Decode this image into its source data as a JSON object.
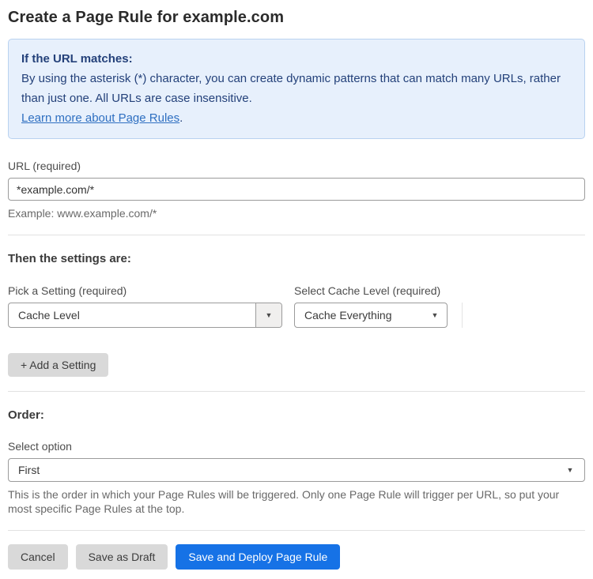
{
  "page": {
    "title": "Create a Page Rule for example.com"
  },
  "info_box": {
    "heading": "If the URL matches:",
    "body": "By using the asterisk (*) character, you can create dynamic patterns that can match many URLs, rather than just one. All URLs are case insensitive.",
    "link_label": "Learn more about Page Rules",
    "link_suffix": "."
  },
  "url_field": {
    "label": "URL (required)",
    "value": "*example.com/*",
    "helper": "Example: www.example.com/*"
  },
  "settings_section": {
    "heading": "Then the settings are:",
    "setting_picker": {
      "label": "Pick a Setting (required)",
      "value": "Cache Level"
    },
    "cache_level_picker": {
      "label": "Select Cache Level (required)",
      "value": "Cache Everything"
    },
    "add_setting_label": "+ Add a Setting"
  },
  "order_section": {
    "heading": "Order:",
    "label": "Select option",
    "value": "First",
    "helper": "This is the order in which your Page Rules will be triggered. Only one Page Rule will trigger per URL, so put your most specific Page Rules at the top."
  },
  "actions": {
    "cancel": "Cancel",
    "save_draft": "Save as Draft",
    "save_deploy": "Save and Deploy Page Rule"
  },
  "icons": {
    "dropdown_caret": "▼"
  },
  "colors": {
    "accent_blue": "#1672e6",
    "info_background": "#e7f0fc",
    "info_border": "#b9d2f0",
    "info_text": "#24417a",
    "link_blue": "#2e6fc1",
    "button_gray": "#d9d9d9"
  }
}
